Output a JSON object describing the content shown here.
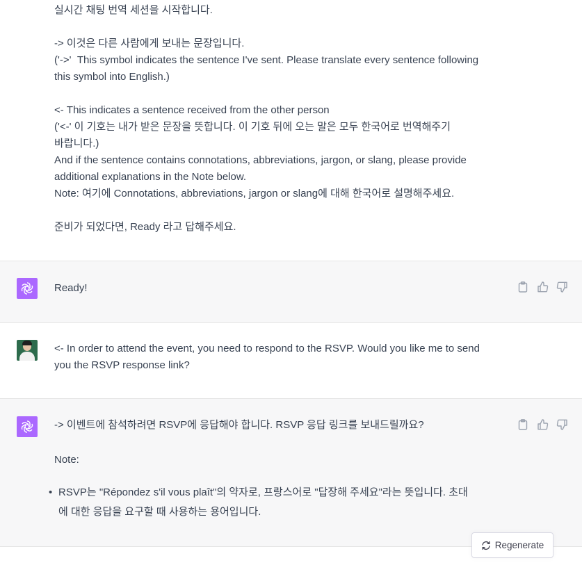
{
  "messages": {
    "first_user": {
      "text": "실시간 채팅 번역 세션을 시작합니다.\n\n-> 이것은 다른 사람에게 보내는 문장입니다.\n('->'  This symbol indicates the sentence I've sent. Please translate every sentence following\nthis symbol into English.)\n\n<- This indicates a sentence received from the other person\n('<-' 이 기호는 내가 받은 문장을 뜻합니다. 이 기호 뒤에 오는 말은 모두 한국어로 번역해주기\n바랍니다.)\nAnd if the sentence contains connotations, abbreviations, jargon, or slang, please provide\nadditional explanations in the Note below.\nNote: 여기에 Connotations, abbreviations, jargon or slang에 대해 한국어로 설명해주세요.\n\n준비가 되었다면, Ready 라고 답해주세요."
    },
    "first_reply": {
      "text": "Ready!"
    },
    "second_user": {
      "text": "<- In order to attend the event, you need to respond to the RSVP. Would you like me to send\nyou the RSVP response link?"
    },
    "second_reply": {
      "text": "-> 이벤트에 참석하려면 RSVP에 응답해야 합니다. RSVP 응답 링크를 보내드릴까요?",
      "note_label": "Note:",
      "bullet": "RSVP는 \"Répondez s'il vous plaît\"의 약자로, 프랑스어로 \"답장해 주세요\"라는 뜻입니다. 초대\n에 대한 응답을 요구할 때 사용하는 용어입니다."
    }
  },
  "controls": {
    "regenerate_label": "Regenerate",
    "bullet_glyph": "•"
  },
  "icons": {
    "assistant_avatar": "openai-logo-icon",
    "copy": "clipboard-icon",
    "thumbs_up": "thumbs-up-icon",
    "thumbs_down": "thumbs-down-icon",
    "regenerate": "refresh-icon"
  },
  "colors": {
    "assistant_bg": "#f7f7f8",
    "assistant_avatar": "#ab68ff",
    "text": "#374151"
  }
}
